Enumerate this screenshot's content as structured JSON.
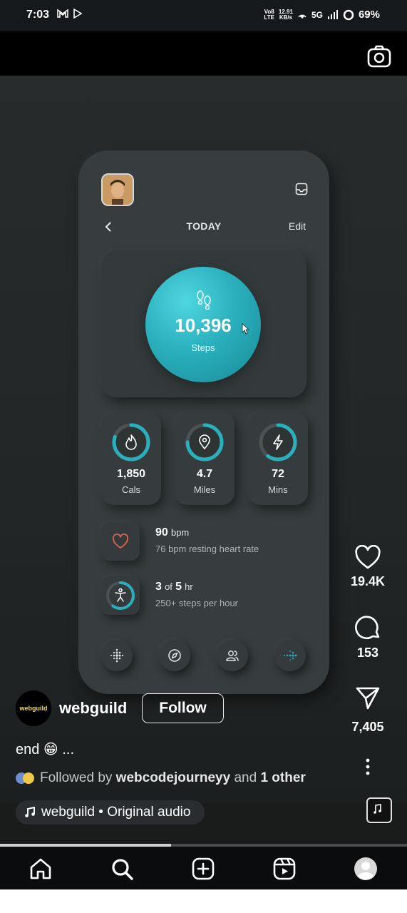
{
  "status_bar": {
    "time": "7:03",
    "left_icons": [
      "gmail-icon",
      "play-store-icon"
    ],
    "network_label_top": "Vo8",
    "network_label_bottom": "LTE",
    "speed_top": "12.91",
    "speed_bottom": "KB/s",
    "signal": "5G",
    "battery": "69%"
  },
  "app": {
    "header": {
      "today": "TODAY",
      "edit": "Edit"
    },
    "steps": {
      "value": "10,396",
      "label": "Steps"
    },
    "stats": [
      {
        "value": "1,850",
        "label": "Cals",
        "icon": "flame-icon",
        "progress": 0.8
      },
      {
        "value": "4.7",
        "label": "Miles",
        "icon": "location-pin-icon",
        "progress": 0.75
      },
      {
        "value": "72",
        "label": "Mins",
        "icon": "lightning-icon",
        "progress": 0.6
      }
    ],
    "heart": {
      "value": "90",
      "unit": "bpm",
      "sub": "76 bpm resting heart rate"
    },
    "activity": {
      "value1": "3",
      "of": "of",
      "value2": "5",
      "unit": "hr",
      "sub": "250+ steps per hour",
      "progress": 0.6
    },
    "bottom_nav": [
      "fitbit-dots-icon",
      "compass-icon",
      "people-icon",
      "arrow-dots-icon"
    ]
  },
  "actions": {
    "likes": "19.4K",
    "comments": "153",
    "shares": "7,405"
  },
  "post": {
    "logo_text": "webguild",
    "username": "webguild",
    "follow": "Follow",
    "caption": "end 😁 ...",
    "followed_prefix": "Followed by",
    "followed_user": "webcodejourneyy",
    "followed_and": "and",
    "followed_other": "1 other",
    "audio": "webguild • Original audio"
  },
  "video_progress": 0.42,
  "colors": {
    "accent_teal": "#2ab0bd",
    "heart_red": "#e0604f",
    "phone_bg": "#373d3e"
  }
}
